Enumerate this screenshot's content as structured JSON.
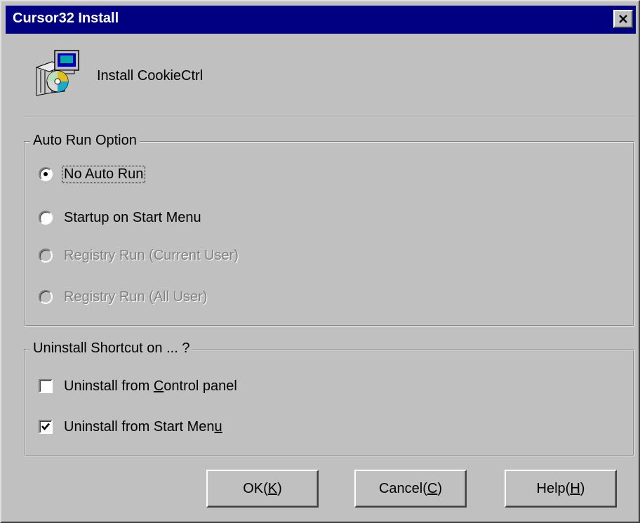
{
  "window": {
    "title": "Cursor32 Install",
    "close_glyph": "✕"
  },
  "header": {
    "icon": "installer-icon",
    "label": "Install CookieCtrl"
  },
  "auto_run": {
    "title": "Auto Run Option",
    "options": [
      {
        "label": "No Auto Run",
        "selected": true,
        "enabled": true,
        "focused": true
      },
      {
        "label": "Startup on Start Menu",
        "selected": false,
        "enabled": true,
        "focused": false
      },
      {
        "label": "Registry Run (Current User)",
        "selected": false,
        "enabled": false,
        "focused": false
      },
      {
        "label": "Registry Run (All User)",
        "selected": false,
        "enabled": false,
        "focused": false
      }
    ]
  },
  "uninstall": {
    "title": "Uninstall Shortcut on ... ?",
    "options": [
      {
        "before": "Uninstall from ",
        "accel": "C",
        "after": "ontrol panel",
        "checked": false
      },
      {
        "before": "Uninstall from Start Men",
        "accel": "u",
        "after": "",
        "checked": true
      }
    ]
  },
  "buttons": {
    "ok": {
      "before": "OK(",
      "accel": "K",
      "after": ")"
    },
    "cancel": {
      "before": "Cancel(",
      "accel": "C",
      "after": ")"
    },
    "help": {
      "before": "Help(",
      "accel": "H",
      "after": ")"
    }
  },
  "colors": {
    "titlebar": "#000080",
    "face": "#c0c0c0",
    "disabled_text": "#808080"
  }
}
